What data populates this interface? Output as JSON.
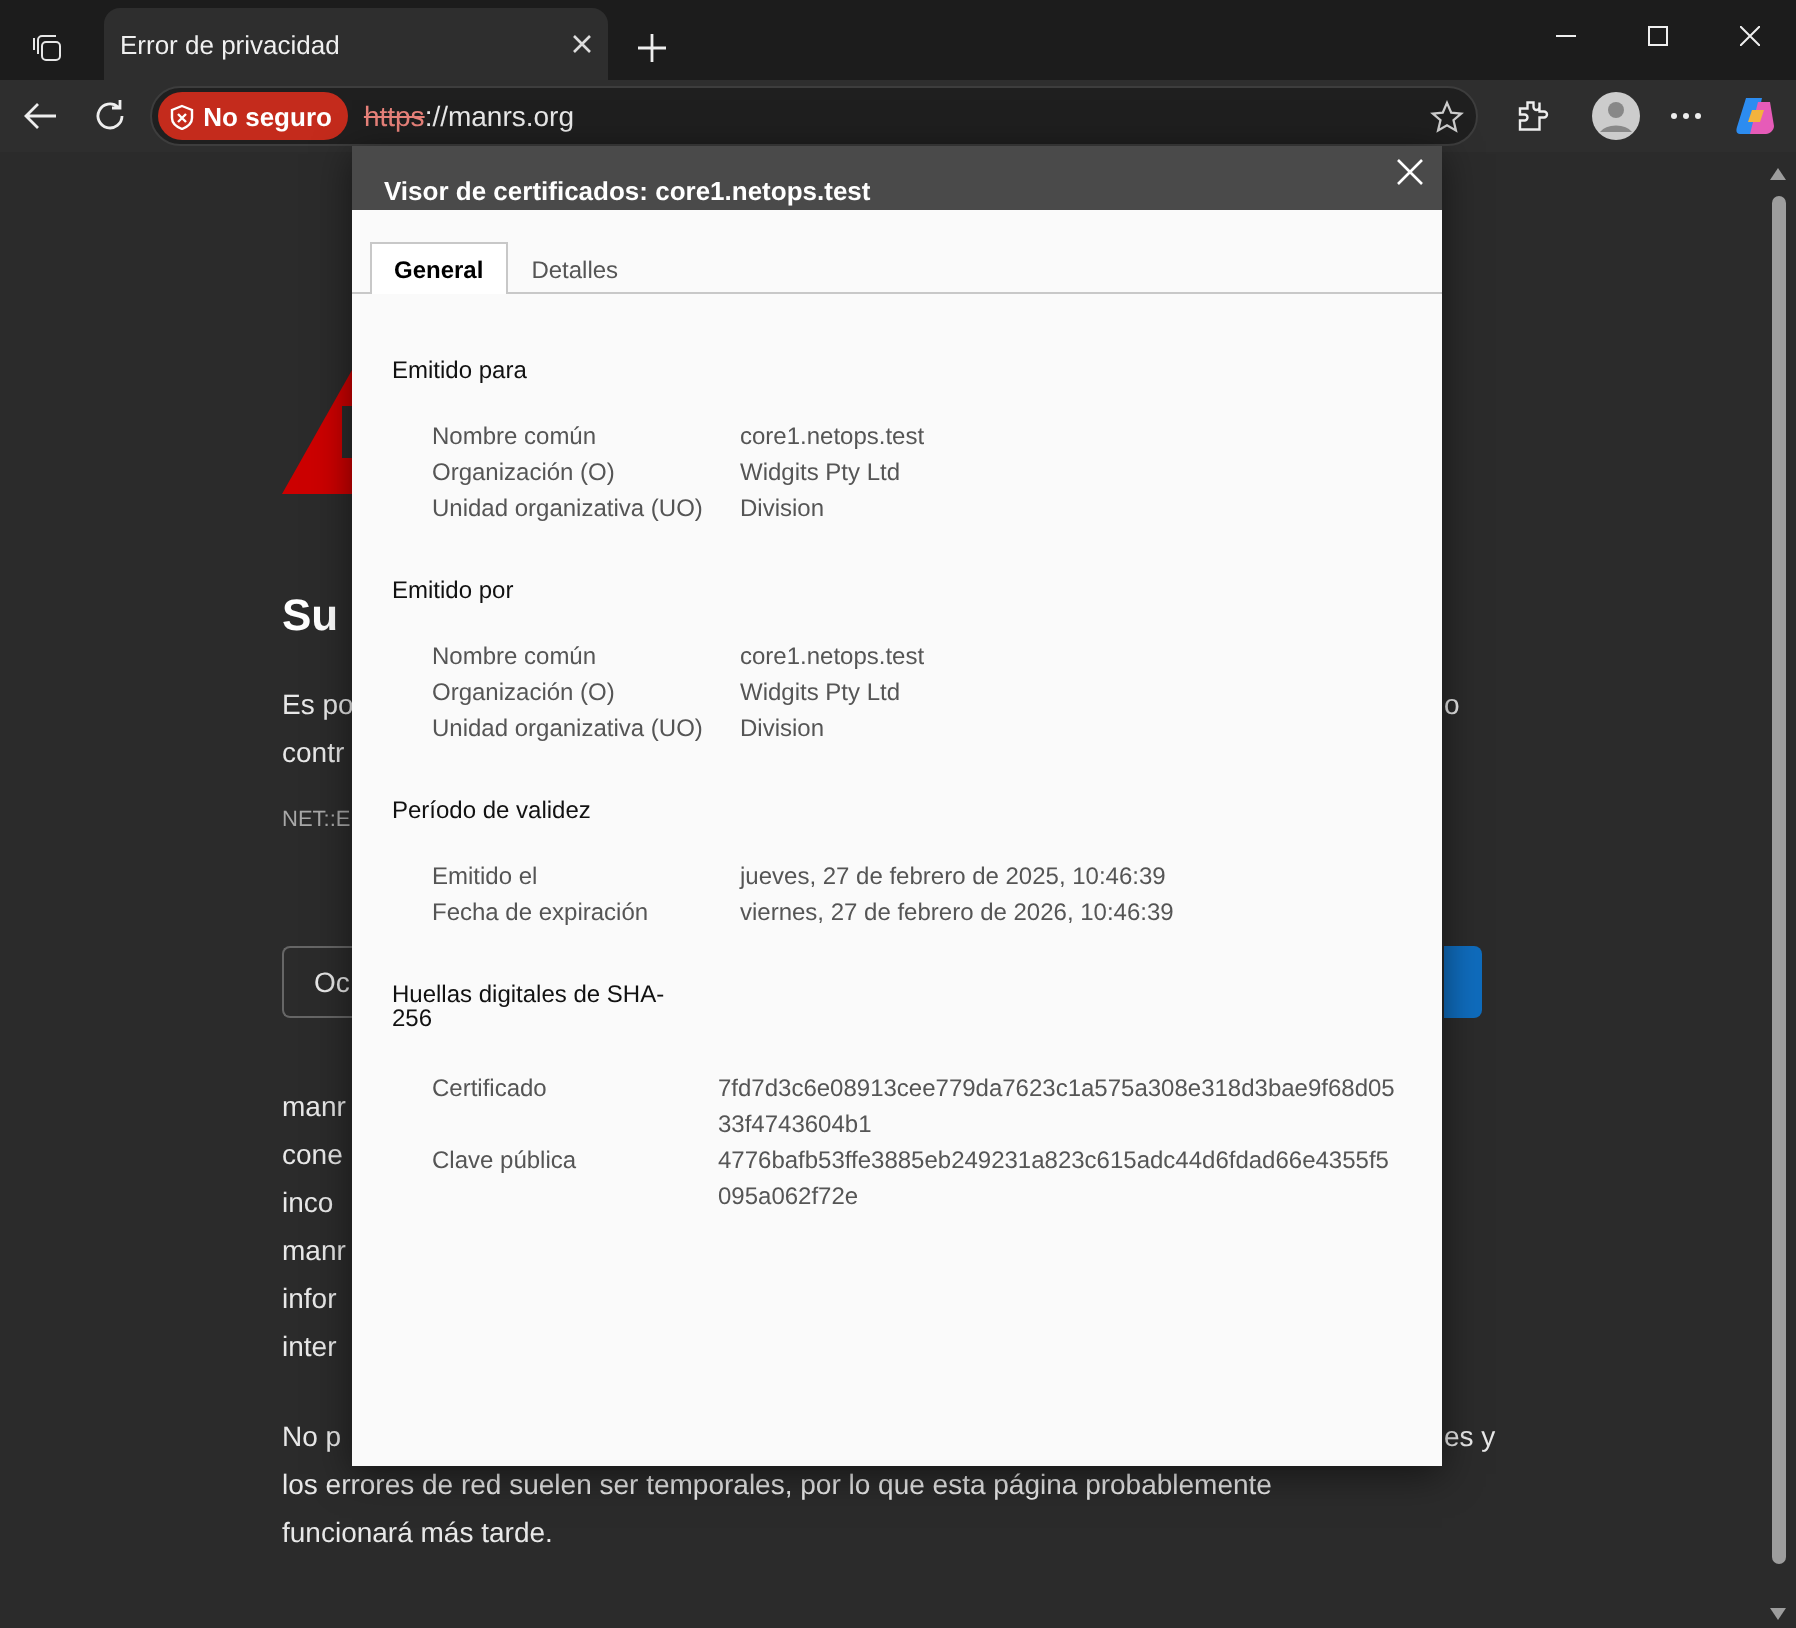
{
  "browser": {
    "tabs": [
      {
        "title": "Error de privacidad",
        "selected": true
      }
    ],
    "security_badge": "No seguro",
    "url": {
      "scheme": "https",
      "rest": "://manrs.org"
    }
  },
  "page": {
    "heading": "Su",
    "intro_left": [
      "Es po",
      "contr"
    ],
    "intro_right": "o",
    "error_code": "NET::E",
    "secondary_button": "Oc",
    "details_left": [
      "manr",
      "cone",
      "inco",
      "manr",
      "infor",
      "inter"
    ],
    "closing_first_left": "No p",
    "closing_first_right": "es y",
    "closing_lines": [
      "los errores de red suelen ser temporales, por lo que esta página probablemente",
      "funcionará más tarde."
    ]
  },
  "dialog": {
    "title": "Visor de certificados: core1.netops.test",
    "tabs": [
      {
        "label": "General",
        "selected": true
      },
      {
        "label": "Detalles",
        "selected": false
      }
    ],
    "sections": [
      {
        "heading": "Emitido para",
        "rows": [
          {
            "label": "Nombre común",
            "value": "core1.netops.test"
          },
          {
            "label": "Organización (O)",
            "value": "Widgits Pty Ltd"
          },
          {
            "label": "Unidad organizativa (UO)",
            "value": "Division"
          }
        ]
      },
      {
        "heading": "Emitido por",
        "rows": [
          {
            "label": "Nombre común",
            "value": "core1.netops.test"
          },
          {
            "label": "Organización (O)",
            "value": "Widgits Pty Ltd"
          },
          {
            "label": "Unidad organizativa (UO)",
            "value": "Division"
          }
        ]
      },
      {
        "heading": "Período de validez",
        "rows": [
          {
            "label": "Emitido el",
            "value": "jueves, 27 de febrero de 2025, 10:46:39"
          },
          {
            "label": "Fecha de expiración",
            "value": "viernes, 27 de febrero de 2026, 10:46:39"
          }
        ]
      },
      {
        "heading": "Huellas digitales de SHA-256",
        "kind": "fingerprint",
        "rows": [
          {
            "label": "Certificado",
            "value": "7fd7d3c6e08913cee779da7623c1a575a308e318d3bae9f68d0533f4743604b1"
          },
          {
            "label": "Clave pública",
            "value": "4776bafb53ffe3885eb249231a823c615adc44d6fdad66e4355f5095a062f72e"
          }
        ]
      }
    ]
  }
}
